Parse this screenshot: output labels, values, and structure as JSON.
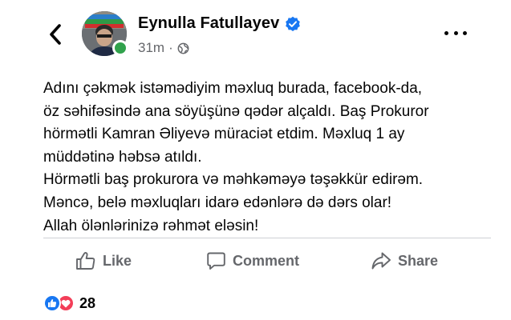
{
  "header": {
    "author_name": "Eynulla  Fatullayev",
    "time": "31m",
    "separator": "·",
    "privacy_icon": "globe-icon",
    "verified_icon": "verified-badge-icon",
    "back_icon": "chevron-left-icon",
    "more_icon": "more-horizontal-icon"
  },
  "post": {
    "lines": [
      "Adını çəkmək istəmədiyim məxluq burada, facebook-da,",
      "öz səhifəsində ana söyüşünə qədər alçaldı. Baş Prokuror",
      "hörmətli Kamran Əliyevə müraciət etdim. Məxluq 1 ay",
      "müddətinə həbsə atıldı.",
      "Hörmətli baş prokurora və məhkəməyə təşəkkür edirəm.",
      "Məncə, belə məxluqları idarə edənlərə də dərs olar!",
      "Allah ölənlərinizə rəhmət eləsin!"
    ]
  },
  "actions": {
    "like_label": "Like",
    "comment_label": "Comment",
    "share_label": "Share"
  },
  "reactions": {
    "count": "28",
    "types": [
      "like",
      "love"
    ]
  },
  "colors": {
    "verified": "#1877f2",
    "online": "#31a24c",
    "secondary_text": "#65676b",
    "like_reaction": "#1877f2",
    "love_reaction": "#f33e58"
  }
}
